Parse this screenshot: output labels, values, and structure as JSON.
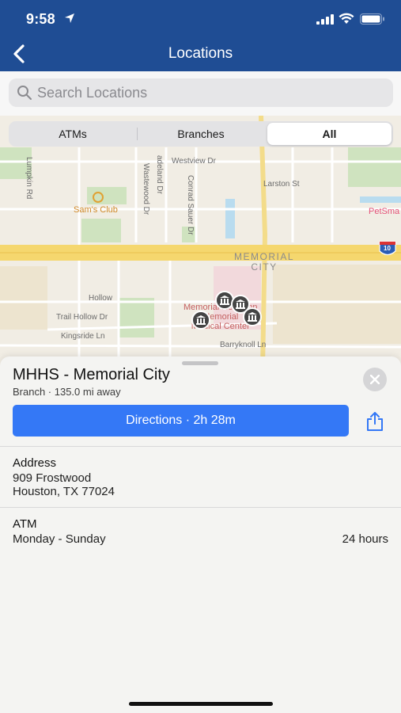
{
  "status_bar": {
    "time": "9:58"
  },
  "nav": {
    "title": "Locations"
  },
  "search": {
    "placeholder": "Search Locations"
  },
  "filter": {
    "options": [
      "ATMs",
      "Branches",
      "All"
    ],
    "selected": "All"
  },
  "map": {
    "labels": {
      "lumpkin": "Lumpkin Rd",
      "westview": "Westview Dr",
      "larston": "Larston St",
      "sams": "Sam's Club",
      "petsmart": "PetSma",
      "wasterwood": "Wastewood Dr",
      "adeland": "adeland Dr",
      "conrad": "Conrad Sauer Dr",
      "memorial_city": "MEMORIAL\nCITY",
      "interstate": "10",
      "trail_hollow": "Trail Hollow Dr",
      "kingsride": "Kingsride Ln",
      "barryknoll": "Barryknoll Ln",
      "hospital": "Memorial Hermann\nMemorial\nMedical Center",
      "hollow": "Hollow"
    }
  },
  "place": {
    "name": "MHHS - Memorial City",
    "subtitle": "Branch · 135.0 mi away",
    "directions_label": "Directions · 2h 28m"
  },
  "address": {
    "heading": "Address",
    "line1": "909 Frostwood",
    "line2": "Houston, TX 77024"
  },
  "hours": {
    "heading": "ATM",
    "days": "Monday - Sunday",
    "value": "24 hours"
  },
  "colors": {
    "header": "#1f4d94",
    "accent": "#3478f6",
    "freeway": "#f5d76e"
  },
  "icons": [
    "location-arrow-icon",
    "signal-icon",
    "wifi-icon",
    "battery-icon",
    "back-chevron-icon",
    "search-icon",
    "bank-icon",
    "close-icon",
    "share-icon"
  ]
}
